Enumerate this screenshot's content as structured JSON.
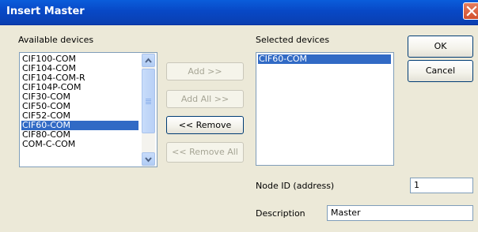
{
  "window": {
    "title": "Insert Master"
  },
  "available": {
    "label": "Available devices",
    "items": [
      "CIF100-COM",
      "CIF104-COM",
      "CIF104-COM-R",
      "CIF104P-COM",
      "CIF30-COM",
      "CIF50-COM",
      "CIF52-COM",
      "CIF60-COM",
      "CIF80-COM",
      "COM-C-COM"
    ],
    "selected_item": "CIF60-COM"
  },
  "buttons": {
    "add": "Add >>",
    "add_all": "Add All >>",
    "remove": "<< Remove",
    "remove_all": "<< Remove All",
    "ok": "OK",
    "cancel": "Cancel"
  },
  "selected": {
    "label": "Selected devices",
    "items": [
      "CIF60-COM"
    ]
  },
  "node_id": {
    "label": "Node ID (address)",
    "value": "1"
  },
  "description": {
    "label": "Description",
    "value": "Master"
  },
  "colors": {
    "titlebar": "#0a48c6",
    "selection": "#316ac5",
    "dialog_bg": "#ece9d8",
    "close": "#d2512d"
  },
  "icons": [
    "close-icon",
    "scroll-up-arrow-icon",
    "scroll-down-arrow-icon"
  ]
}
